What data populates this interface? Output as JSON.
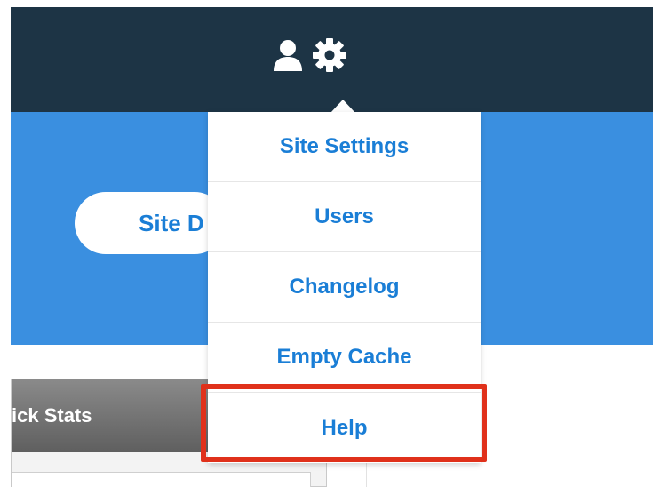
{
  "header": {
    "user_icon": "user-icon",
    "settings_icon": "gear-icon"
  },
  "hero": {
    "site_button_label": "Site D"
  },
  "stats": {
    "title": "ick Stats"
  },
  "settings_menu": {
    "items": [
      {
        "label": "Site Settings"
      },
      {
        "label": "Users"
      },
      {
        "label": "Changelog"
      },
      {
        "label": "Empty Cache"
      },
      {
        "label": "Help"
      }
    ]
  },
  "annotation": {
    "highlight_color": "#e0311b",
    "highlighted_item": "Help"
  },
  "colors": {
    "topbar": "#1d3445",
    "hero": "#3a8fe0",
    "link": "#1a7ed6"
  }
}
